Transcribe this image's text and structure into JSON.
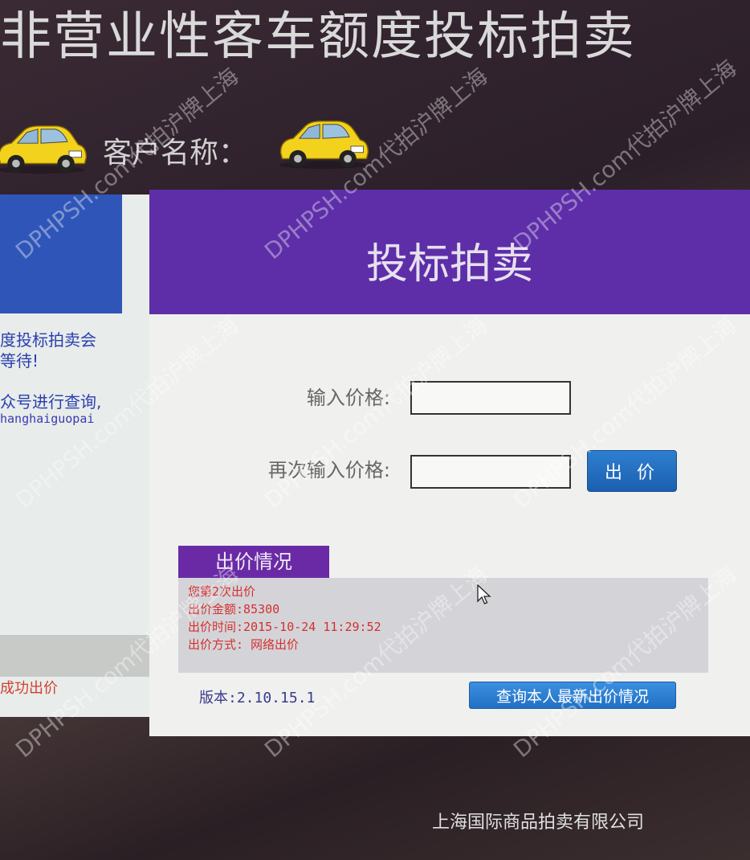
{
  "page": {
    "title": "非营业性客车额度投标拍卖",
    "customer_label": "客户名称："
  },
  "left_panel": {
    "notice_line1": "度投标拍卖会",
    "notice_line2": "等待!",
    "query_text": "众号进行查询,",
    "link_text": "hanghaiguopai",
    "bottom_text": "成功出价"
  },
  "main_panel": {
    "title": "投标拍卖",
    "price_label": "输入价格:",
    "price_confirm_label": "再次输入价格:",
    "price_value": "",
    "price_confirm_value": "",
    "bid_button_label": "出 价"
  },
  "bid_status": {
    "tab_label": "出价情况",
    "lines": [
      "您第2次出价",
      "出价金额:85300",
      "出价时间:2015-10-24 11:29:52",
      "出价方式: 网络出价"
    ]
  },
  "footer": {
    "version": "版本:2.10.15.1",
    "query_button_label": "查询本人最新出价情况",
    "company": "上海国际商品拍卖有限公司"
  },
  "watermark": {
    "text": "DPHPSH.com代拍沪牌上海"
  },
  "icons": {
    "car": "car-icon",
    "cursor": "mouse-cursor-icon"
  },
  "colors": {
    "main_header": "#5d2ea8",
    "left_header": "#2f55b8",
    "bid_button": "#1b5fb0",
    "status_text": "#d43030"
  }
}
